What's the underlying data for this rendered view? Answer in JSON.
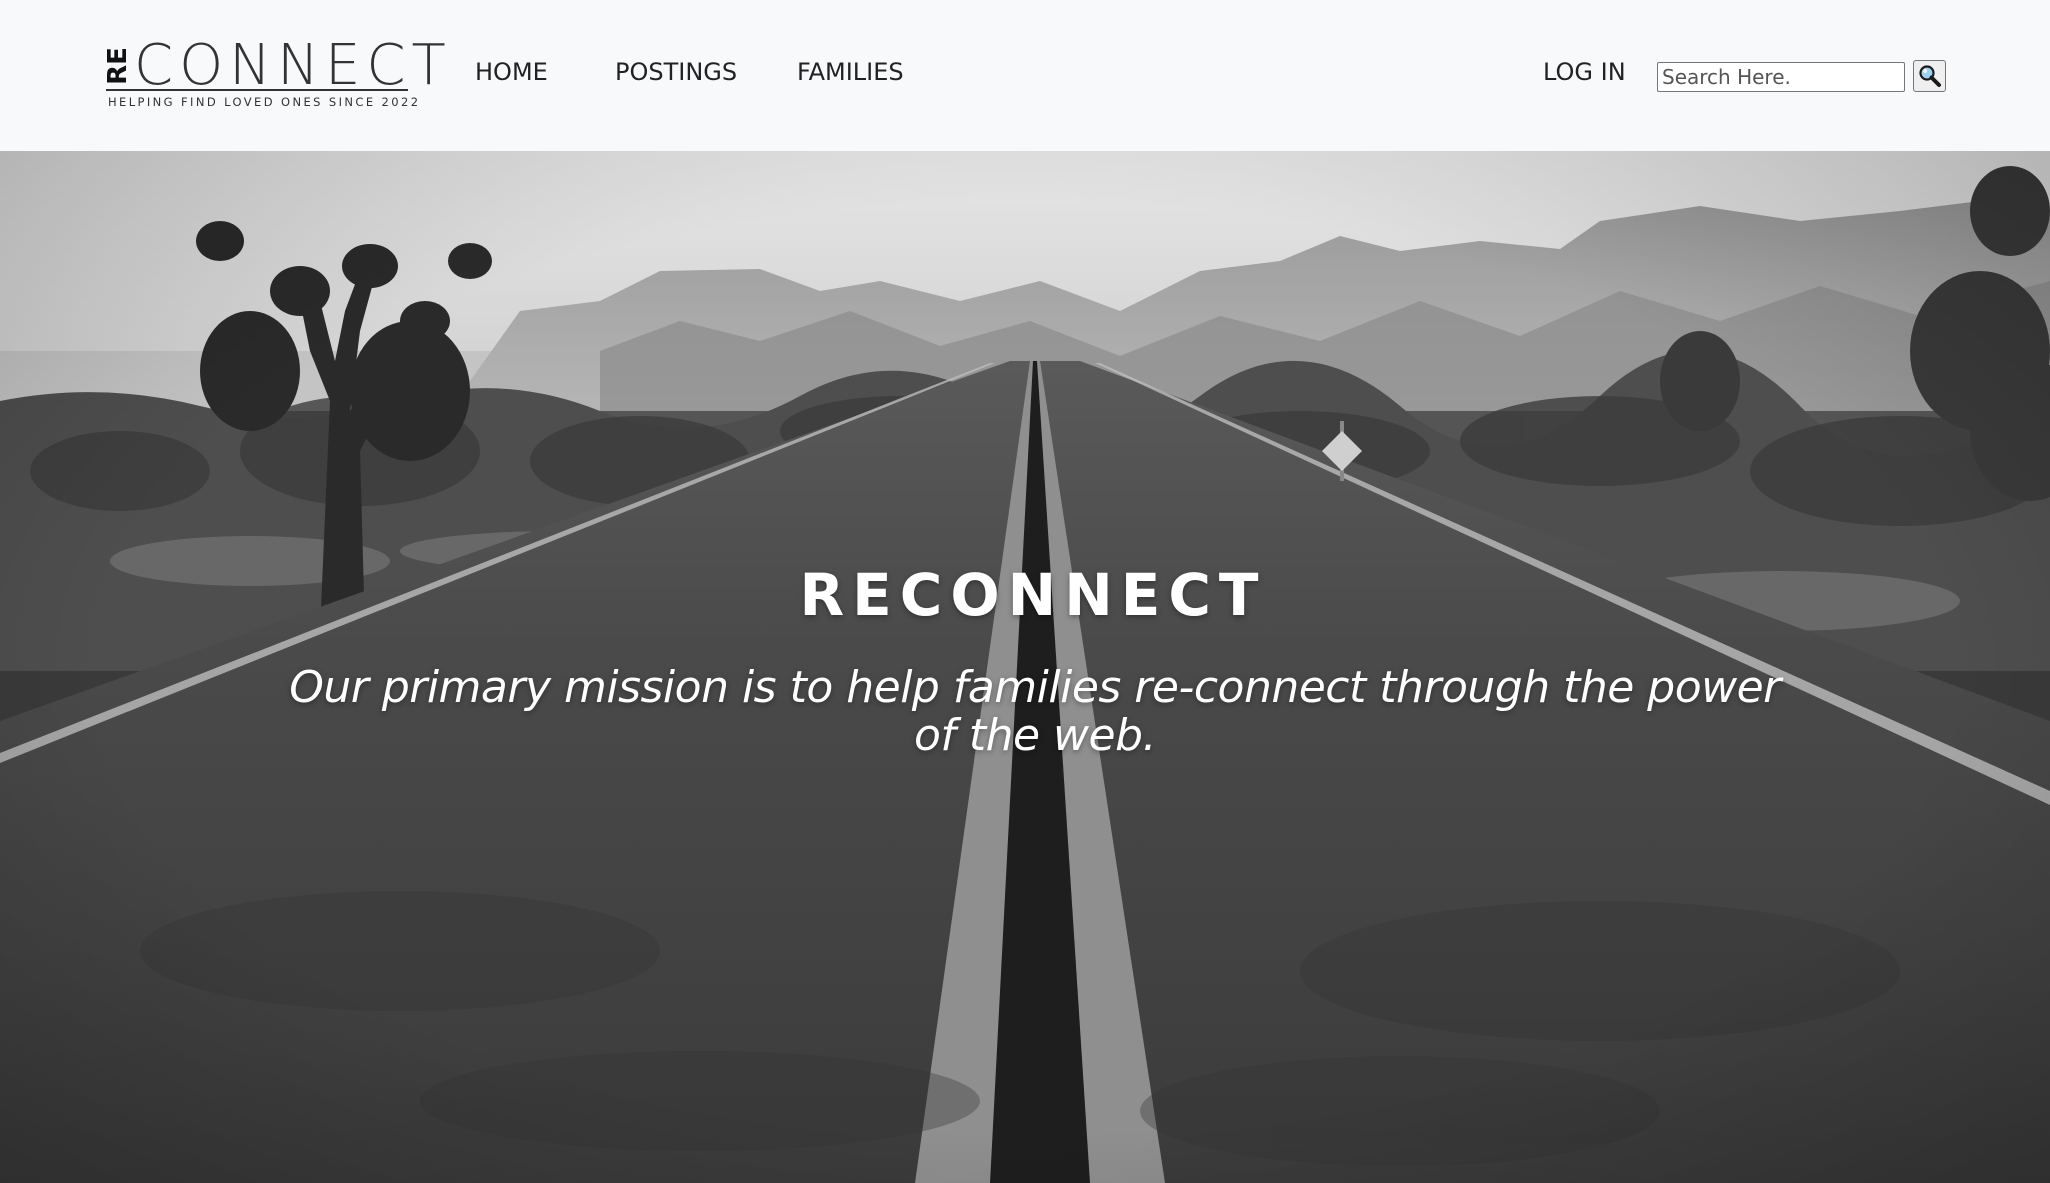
{
  "brand": {
    "prefix": "RE",
    "name": "CONNECT",
    "tagline": "HELPING FIND LOVED ONES SINCE 2022"
  },
  "nav": {
    "items": [
      {
        "label": "HOME"
      },
      {
        "label": "POSTINGS"
      },
      {
        "label": "FAMILIES"
      }
    ],
    "login_label": "LOG IN"
  },
  "search": {
    "placeholder": "Search Here.",
    "value": "",
    "icon": "magnifier-icon"
  },
  "hero": {
    "title": "RECONNECT",
    "mission": "Our primary mission is to help families re-connect through the power of the web.",
    "image": "grayscale desert road with joshua trees and mountains"
  },
  "colors": {
    "header_bg": "#f8f9fb",
    "text_dark": "#222222",
    "hero_text": "#ffffff"
  }
}
